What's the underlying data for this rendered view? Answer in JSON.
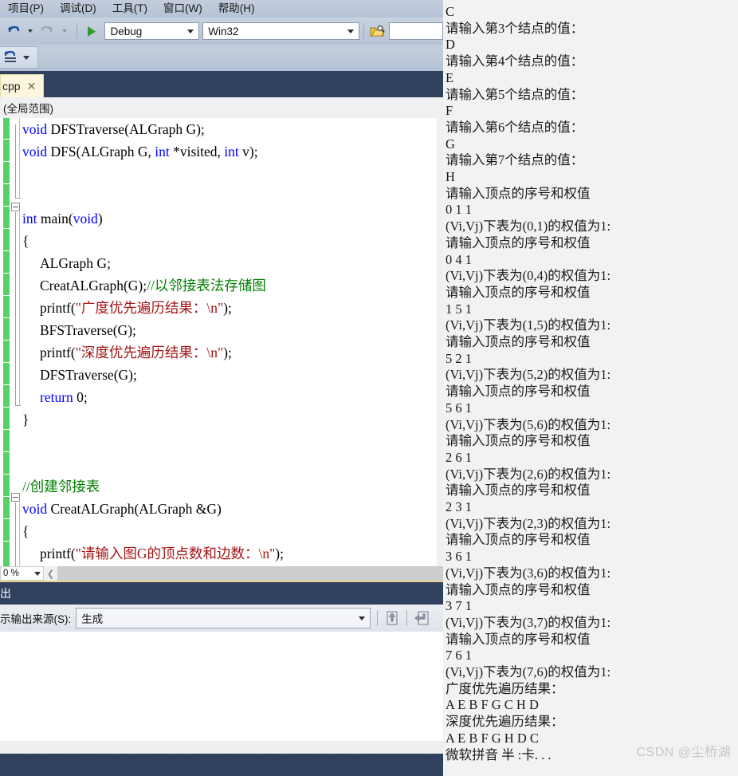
{
  "ide": {
    "menu": [
      {
        "label": "项目(P)"
      },
      {
        "label": "调试(D)"
      },
      {
        "label": "工具(T)"
      },
      {
        "label": "窗口(W)"
      },
      {
        "label": "帮助(H)"
      }
    ],
    "toolbar": {
      "undo_icon": "undo-icon",
      "redo_icon": "redo-icon",
      "start_debug_icon": "start-debugging-icon",
      "configuration": "Debug",
      "platform": "Win32",
      "find_icon": "find-in-files-icon",
      "search_value": ""
    },
    "toolbar2": {
      "undo_stack_icon": "undo-list-icon",
      "overflow_icon": "toolbar-overflow-icon"
    },
    "tab": {
      "label": "cpp",
      "close_icon": "close-icon"
    },
    "navbar": {
      "scope": "(全局范围)"
    },
    "editor": {
      "zoom": "0 %",
      "scroll_left_icon": "scroll-left-icon",
      "lines": [
        {
          "indent": 0,
          "segs": [
            {
              "t": "void",
              "c": "kw"
            },
            {
              "t": " DFSTraverse(ALGraph G);",
              "c": "pln"
            }
          ]
        },
        {
          "indent": 0,
          "segs": [
            {
              "t": "void",
              "c": "kw"
            },
            {
              "t": " DFS(ALGraph G, ",
              "c": "pln"
            },
            {
              "t": "int",
              "c": "kw"
            },
            {
              "t": " *visited, ",
              "c": "pln"
            },
            {
              "t": "int",
              "c": "kw"
            },
            {
              "t": " v);",
              "c": "pln"
            }
          ]
        },
        {
          "indent": 0,
          "segs": []
        },
        {
          "indent": 0,
          "segs": []
        },
        {
          "indent": 0,
          "segs": [
            {
              "t": "int",
              "c": "kw"
            },
            {
              "t": " main(",
              "c": "pln"
            },
            {
              "t": "void",
              "c": "kw"
            },
            {
              "t": ")",
              "c": "pln"
            }
          ]
        },
        {
          "indent": 0,
          "segs": [
            {
              "t": "{",
              "c": "pln"
            }
          ]
        },
        {
          "indent": 1,
          "segs": [
            {
              "t": "ALGraph G;",
              "c": "pln"
            }
          ]
        },
        {
          "indent": 1,
          "segs": [
            {
              "t": "CreatALGraph(G);",
              "c": "pln"
            },
            {
              "t": "//以邻接表法存储图",
              "c": "cmt"
            }
          ]
        },
        {
          "indent": 1,
          "segs": [
            {
              "t": "printf(",
              "c": "pln"
            },
            {
              "t": "\"广度优先遍历结果：\\n\"",
              "c": "str"
            },
            {
              "t": ");",
              "c": "pln"
            }
          ]
        },
        {
          "indent": 1,
          "segs": [
            {
              "t": "BFSTraverse(G);",
              "c": "pln"
            }
          ]
        },
        {
          "indent": 1,
          "segs": [
            {
              "t": "printf(",
              "c": "pln"
            },
            {
              "t": "\"深度优先遍历结果：\\n\"",
              "c": "str"
            },
            {
              "t": ");",
              "c": "pln"
            }
          ]
        },
        {
          "indent": 1,
          "segs": [
            {
              "t": "DFSTraverse(G);",
              "c": "pln"
            }
          ]
        },
        {
          "indent": 1,
          "segs": [
            {
              "t": "return",
              "c": "kw"
            },
            {
              "t": " 0;",
              "c": "pln"
            }
          ]
        },
        {
          "indent": 0,
          "segs": [
            {
              "t": "}",
              "c": "pln"
            }
          ]
        },
        {
          "indent": 0,
          "segs": []
        },
        {
          "indent": 0,
          "segs": []
        },
        {
          "indent": 0,
          "segs": [
            {
              "t": "//创建邻接表",
              "c": "cmt"
            }
          ]
        },
        {
          "indent": 0,
          "segs": [
            {
              "t": "void",
              "c": "kw"
            },
            {
              "t": " CreatALGraph(ALGraph &G)",
              "c": "pln"
            }
          ]
        },
        {
          "indent": 0,
          "segs": [
            {
              "t": "{",
              "c": "pln"
            }
          ]
        },
        {
          "indent": 1,
          "segs": [
            {
              "t": "printf(",
              "c": "pln"
            },
            {
              "t": "\"请输入图G的顶点数和边数：\\n\"",
              "c": "str"
            },
            {
              "t": ");",
              "c": "pln"
            }
          ]
        }
      ]
    },
    "output": {
      "title": "出",
      "source_label": "示输出来源(S):",
      "source_value": "生成",
      "goto_prev_icon": "go-to-previous-message-icon",
      "goto_next_icon": "go-to-next-message-icon"
    }
  },
  "console": {
    "lines": [
      "C",
      "请输入第3个结点的值：",
      "D",
      "请输入第4个结点的值：",
      "E",
      "请输入第5个结点的值：",
      "F",
      "请输入第6个结点的值：",
      "G",
      "请输入第7个结点的值：",
      "H",
      "请输入顶点的序号和权值",
      "0 1 1",
      "(Vi,Vj)下表为(0,1)的权值为1:",
      "请输入顶点的序号和权值",
      "0 4 1",
      "(Vi,Vj)下表为(0,4)的权值为1:",
      "请输入顶点的序号和权值",
      "1 5 1",
      "(Vi,Vj)下表为(1,5)的权值为1:",
      "请输入顶点的序号和权值",
      "5 2 1",
      "(Vi,Vj)下表为(5,2)的权值为1:",
      "请输入顶点的序号和权值",
      "5 6 1",
      "(Vi,Vj)下表为(5,6)的权值为1:",
      "请输入顶点的序号和权值",
      "2 6 1",
      "(Vi,Vj)下表为(2,6)的权值为1:",
      "请输入顶点的序号和权值",
      "2 3 1",
      "(Vi,Vj)下表为(2,3)的权值为1:",
      "请输入顶点的序号和权值",
      "3 6 1",
      "(Vi,Vj)下表为(3,6)的权值为1:",
      "请输入顶点的序号和权值",
      "3 7 1",
      "(Vi,Vj)下表为(3,7)的权值为1:",
      "请输入顶点的序号和权值",
      "7 6 1",
      "(Vi,Vj)下表为(7,6)的权值为1:",
      "广度优先遍历结果：",
      "A E B F G C H D",
      "深度优先遍历结果：",
      "A E B F G H D C",
      "微软拼音 半 :卡. . ."
    ]
  },
  "watermark": "CSDN @尘桥湖"
}
